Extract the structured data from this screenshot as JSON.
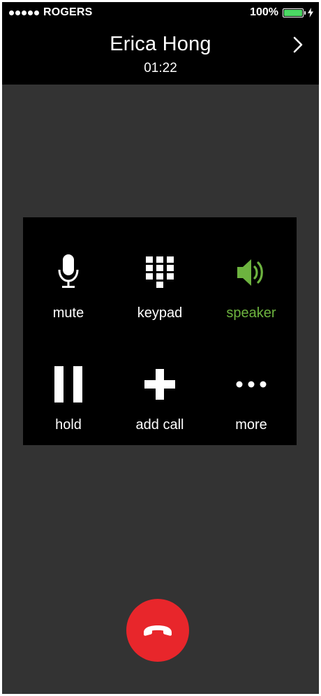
{
  "status_bar": {
    "carrier": "ROGERS",
    "battery_percent": "100%",
    "battery_level": 1.0,
    "signal_bars": 5,
    "battery_color": "#4cd964"
  },
  "call": {
    "caller_name": "Erica Hong",
    "duration": "01:22"
  },
  "controls": [
    {
      "id": "mute",
      "label": "mute",
      "icon": "microphone-icon",
      "active": false
    },
    {
      "id": "keypad",
      "label": "keypad",
      "icon": "keypad-grid-icon",
      "active": false
    },
    {
      "id": "speaker",
      "label": "speaker",
      "icon": "speaker-icon",
      "active": true
    },
    {
      "id": "hold",
      "label": "hold",
      "icon": "pause-icon",
      "active": false
    },
    {
      "id": "add-call",
      "label": "add call",
      "icon": "plus-icon",
      "active": false
    },
    {
      "id": "more",
      "label": "more",
      "icon": "ellipsis-icon",
      "active": false
    }
  ],
  "end_call": {
    "icon": "end-call-icon",
    "color": "#e8262b"
  },
  "colors": {
    "background": "#333333",
    "panel": "#000000",
    "accent_active": "#6db33f"
  }
}
